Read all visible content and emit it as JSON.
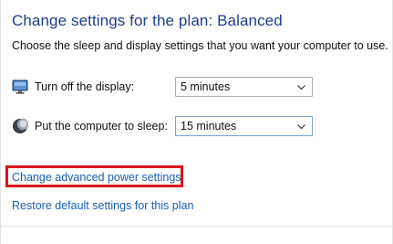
{
  "header": {
    "title": "Change settings for the plan: Balanced",
    "subtitle": "Choose the sleep and display settings that you want your computer to use."
  },
  "settings": {
    "display": {
      "label": "Turn off the display:",
      "value": "5 minutes",
      "icon": "monitor-icon"
    },
    "sleep": {
      "label": "Put the computer to sleep:",
      "value": "15 minutes",
      "icon": "moon-icon"
    }
  },
  "links": {
    "advanced": "Change advanced power settings",
    "restore": "Restore default settings for this plan"
  },
  "colors": {
    "title": "#1e3d8f",
    "link": "#1a5fb4",
    "highlight": "#d9141c"
  }
}
